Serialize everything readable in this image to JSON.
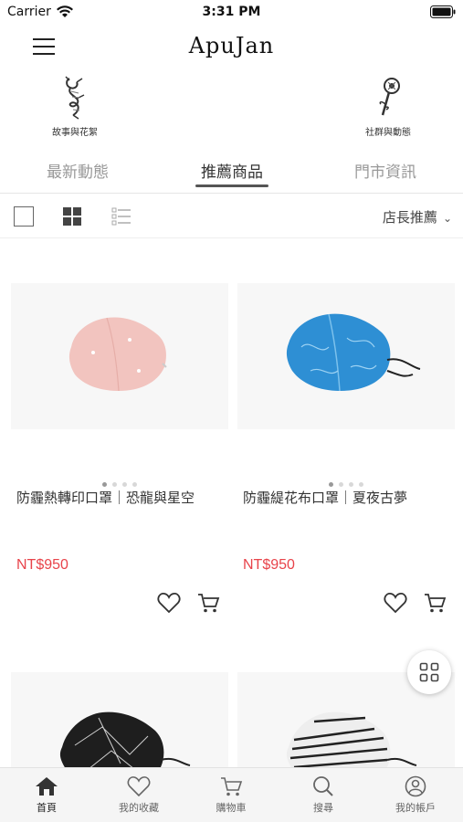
{
  "status_bar": {
    "carrier": "Carrier",
    "time": "3:31 PM"
  },
  "header": {
    "logo": "ApuJan",
    "menu_icon": "hamburger-menu-icon"
  },
  "features": [
    {
      "label": "故事與花絮",
      "icon": "dragon-illustration-icon"
    },
    {
      "label": "社群與動態",
      "icon": "flower-illustration-icon"
    }
  ],
  "tabs": [
    {
      "label": "最新動態",
      "active": false
    },
    {
      "label": "推薦商品",
      "active": true
    },
    {
      "label": "門市資訊",
      "active": false
    }
  ],
  "view_bar": {
    "view_modes": [
      "single-view-icon",
      "grid-view-icon",
      "list-view-icon"
    ],
    "selected_view": "grid-view-icon",
    "sort_label": "店長推薦",
    "sort_icon": "chevron-down-icon"
  },
  "products": [
    {
      "name": "防霾熱轉印口罩｜恐龍與星空",
      "price": "NT$950",
      "image": "pink mask"
    },
    {
      "name": "防霾緹花布口罩｜夏夜古夢",
      "price": "NT$950",
      "image": "blue mask"
    },
    {
      "name": "",
      "price": "",
      "image": "black mask"
    },
    {
      "name": "",
      "price": "",
      "image": "striped mask"
    }
  ],
  "floating_button": {
    "icon": "grid-menu-icon"
  },
  "bottom_nav": [
    {
      "label": "首頁",
      "icon": "home-icon",
      "active": true
    },
    {
      "label": "我的收藏",
      "icon": "heart-icon",
      "active": false
    },
    {
      "label": "購物車",
      "icon": "cart-icon",
      "active": false
    },
    {
      "label": "搜尋",
      "icon": "search-icon",
      "active": false
    },
    {
      "label": "我的帳戶",
      "icon": "account-icon",
      "active": false
    }
  ],
  "colors": {
    "price": "#e8434a",
    "tab_active": "#333333",
    "tab_inactive": "#999999",
    "nav_bg": "#f5f5f5"
  }
}
